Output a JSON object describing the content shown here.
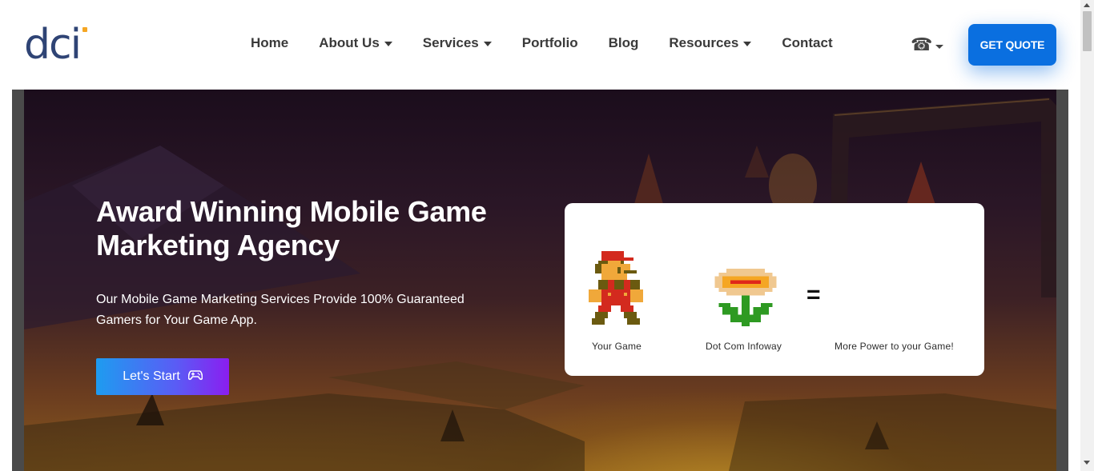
{
  "header": {
    "logo_text": "dci",
    "nav": [
      {
        "label": "Home",
        "has_dropdown": false
      },
      {
        "label": "About Us",
        "has_dropdown": true
      },
      {
        "label": "Services",
        "has_dropdown": true
      },
      {
        "label": "Portfolio",
        "has_dropdown": false
      },
      {
        "label": "Blog",
        "has_dropdown": false
      },
      {
        "label": "Resources",
        "has_dropdown": true
      },
      {
        "label": "Contact",
        "has_dropdown": false
      }
    ],
    "phone_icon": "☎",
    "quote_button": "GET QUOTE"
  },
  "hero": {
    "title": "Award Winning Mobile Game Marketing Agency",
    "subtitle": "Our Mobile Game Marketing Services Provide 100% Guaranteed Gamers for Your Game App.",
    "cta_label": "Let's Start",
    "cta_icon": "gamepad-icon"
  },
  "equation_card": {
    "items": [
      {
        "label": "Your Game",
        "icon": "mario-sprite-icon"
      },
      {
        "label": "Dot Com Infoway",
        "icon": "fire-flower-icon"
      },
      {
        "label": "More Power to your Game!",
        "icon": ""
      }
    ],
    "operator": "="
  },
  "colors": {
    "brand_navy": "#2f4475",
    "accent_blue": "#0a6fe0",
    "logo_accent": "#f5a623"
  }
}
